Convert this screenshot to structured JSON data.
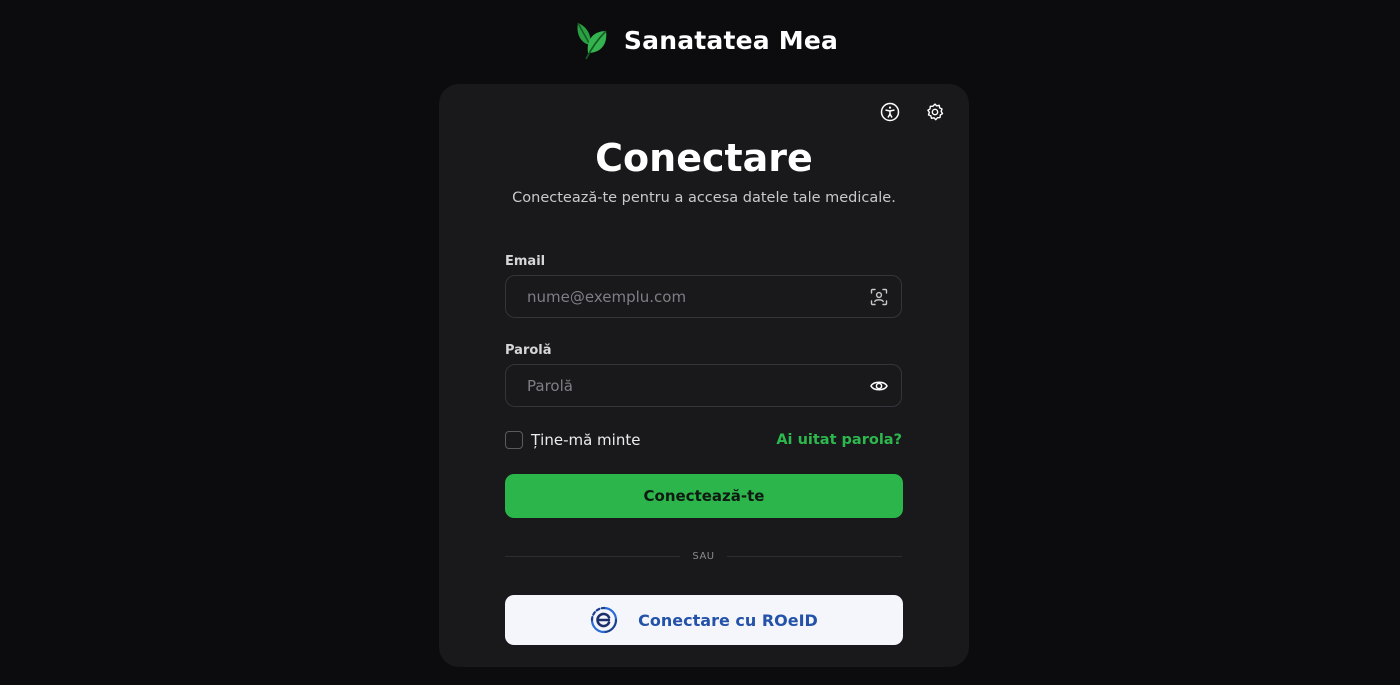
{
  "brand": {
    "name": "Sanatatea Mea",
    "logo_icon": "leaf-icon"
  },
  "card": {
    "toolbar": {
      "accessibility_icon": "accessibility-icon",
      "settings_icon": "gear-icon"
    },
    "title": "Conectare",
    "subtitle": "Conectează-te pentru a accesa datele tale medicale.",
    "email": {
      "label": "Email",
      "placeholder": "nume@exemplu.com",
      "value": "",
      "trailing_icon": "face-scan-icon"
    },
    "password": {
      "label": "Parolă",
      "placeholder": "Parolă",
      "value": "",
      "trailing_icon": "eye-icon"
    },
    "remember_me": {
      "label": "Ține-mă minte",
      "checked": false
    },
    "forgot_password": "Ai uitat parola?",
    "submit_label": "Conectează-te",
    "divider_text": "SAU",
    "roeid": {
      "label": "Conectare cu ROeID",
      "icon": "roeid-logo-icon"
    }
  },
  "colors": {
    "background": "#0c0c0e",
    "card": "#19191c",
    "accent": "#2bb54b",
    "link": "#2db84d",
    "roeid_text": "#2452a8"
  }
}
